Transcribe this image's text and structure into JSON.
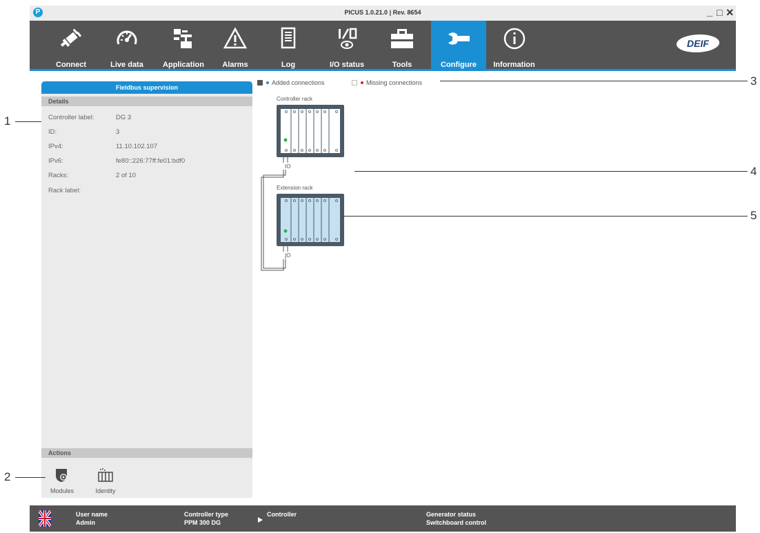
{
  "window": {
    "title": "PICUS 1.0.21.0 | Rev. 8654",
    "app_icon_letter": "P",
    "minimize_glyph": "_",
    "maximize_glyph": "□",
    "close_glyph": "×"
  },
  "toolbar": {
    "items": [
      {
        "label": "Connect",
        "icon": "plug-icon"
      },
      {
        "label": "Live data",
        "icon": "gauge-icon"
      },
      {
        "label": "Application",
        "icon": "single-line-diagram-icon"
      },
      {
        "label": "Alarms",
        "icon": "warning-triangle-icon"
      },
      {
        "label": "Log",
        "icon": "log-document-icon"
      },
      {
        "label": "I/O status",
        "icon": "io-status-icon"
      },
      {
        "label": "Tools",
        "icon": "toolbox-icon"
      },
      {
        "label": "Configure",
        "icon": "wrench-icon"
      },
      {
        "label": "Information",
        "icon": "info-circle-icon"
      }
    ],
    "active": "Configure",
    "accent": "#1b8fd3",
    "brand_logo": "DEIF"
  },
  "panel": {
    "title": "Fieldbus supervision",
    "details_heading": "Details",
    "details": [
      {
        "key": "Controller label:",
        "value": "DG 3"
      },
      {
        "key": "ID:",
        "value": "3"
      },
      {
        "key": "IPv4:",
        "value": "11.10.102.107"
      },
      {
        "key": "IPv6:",
        "value": "fe80::226:77ff:fe01:bdf0"
      },
      {
        "key": "Racks:",
        "value": "2 of 10"
      },
      {
        "key": "Rack label:",
        "value": ""
      }
    ],
    "actions_heading": "Actions",
    "actions": [
      {
        "label": "Modules",
        "icon": "modules-gear-shield-icon"
      },
      {
        "label": "Identity",
        "icon": "identity-rack-icon"
      }
    ]
  },
  "legend": {
    "added": "Added connections",
    "missing": "Missing connections",
    "added_color": "#1b8fd3",
    "missing_color": "#e02020"
  },
  "racks": {
    "controller": {
      "title": "Controller rack",
      "io": "IO"
    },
    "extension": {
      "title": "Extension rack",
      "io": "IO"
    }
  },
  "callouts": [
    "1",
    "2",
    "3",
    "4",
    "5"
  ],
  "status": {
    "user_name_label": "User name",
    "user_name_value": "Admin",
    "controller_type_label": "Controller type",
    "controller_type_value": "PPM 300 DG",
    "controller_label": "Controller",
    "generator_status_label": "Generator status",
    "generator_status_value": "Switchboard control",
    "language_icon": "uk-flag-icon"
  }
}
